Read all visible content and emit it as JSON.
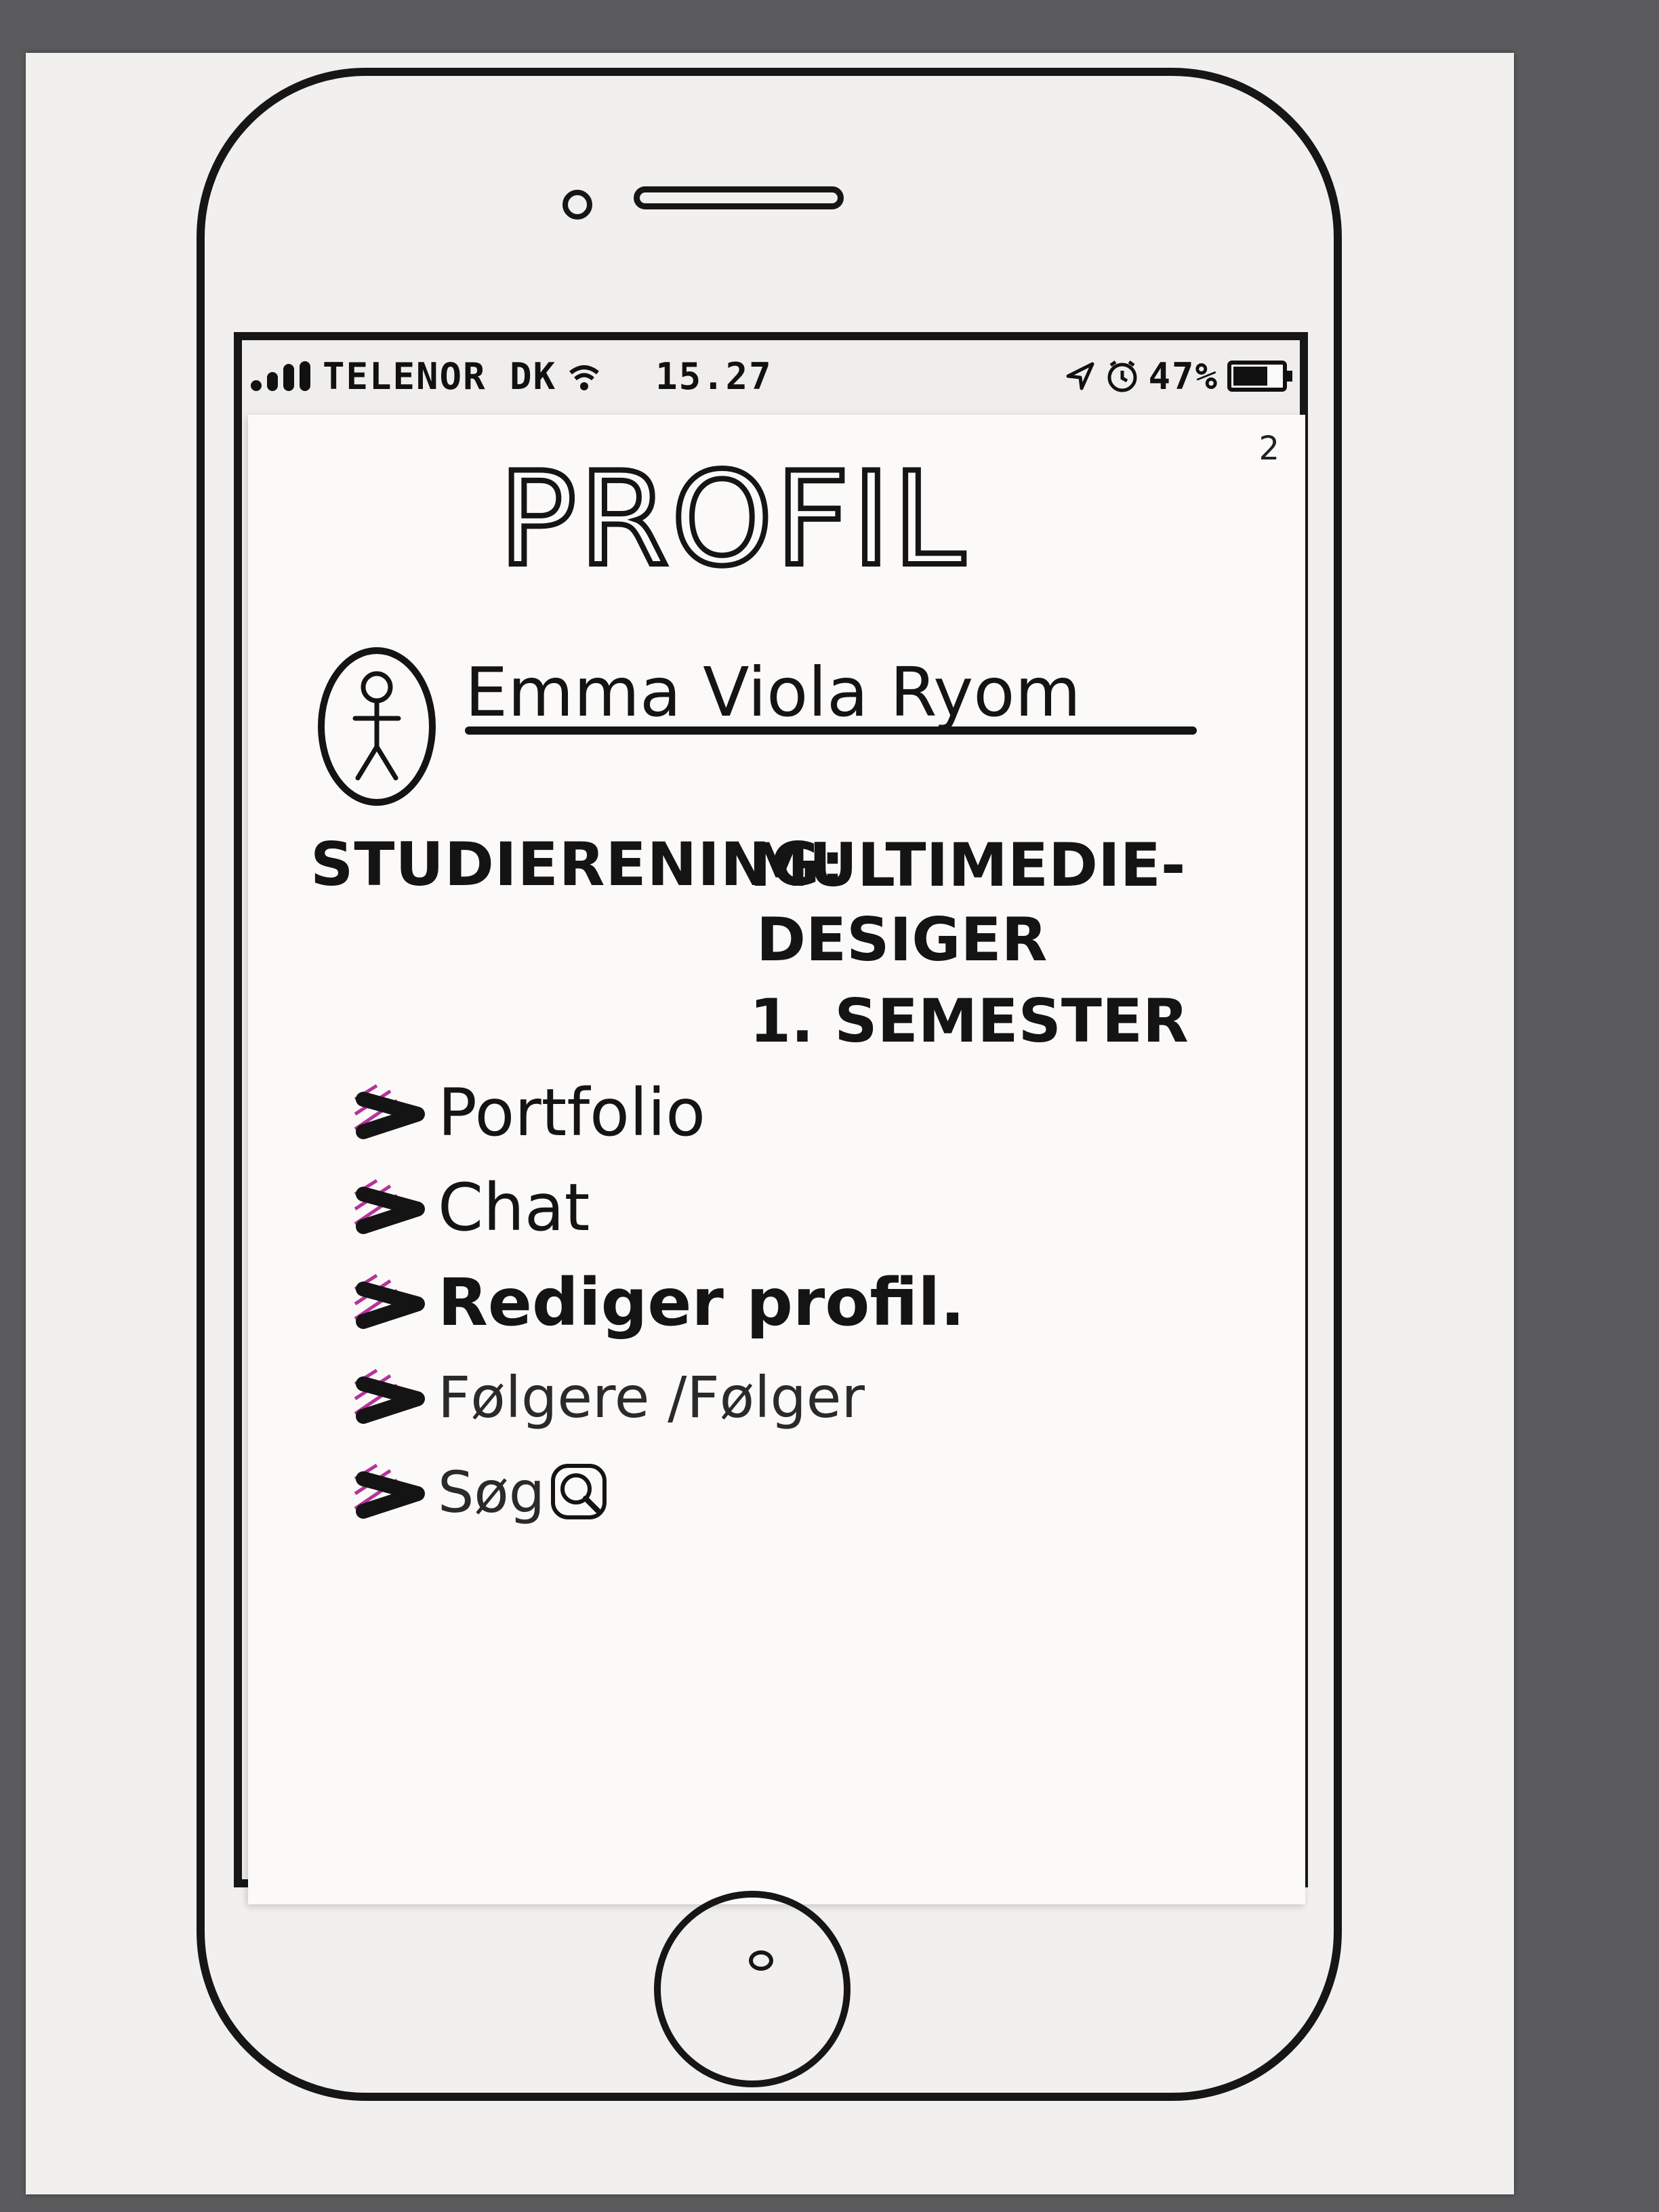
{
  "status_bar": {
    "carrier": "TELENOR DK",
    "time": "15.27",
    "battery": "47%",
    "icons": [
      "signal-icon",
      "wifi-icon",
      "location-icon",
      "alarm-icon",
      "battery-icon"
    ]
  },
  "page": {
    "number": "2",
    "title": "PROFIL"
  },
  "profile": {
    "name": "Emma Viola Ryom",
    "field_label": "STUDIERENING:",
    "field_value_lines": [
      "MULTIMEDIE-",
      "DESIGER",
      "1. SEMESTER"
    ]
  },
  "menu": {
    "items": [
      {
        "label": "Portfolio"
      },
      {
        "label": "Chat"
      },
      {
        "label": "Rediger profil."
      },
      {
        "label": "Følgere /Følger"
      },
      {
        "label": "Søg"
      }
    ]
  },
  "colors": {
    "ink": "#141414",
    "accent": "#b5339c",
    "paper": "#fbfaf8"
  }
}
